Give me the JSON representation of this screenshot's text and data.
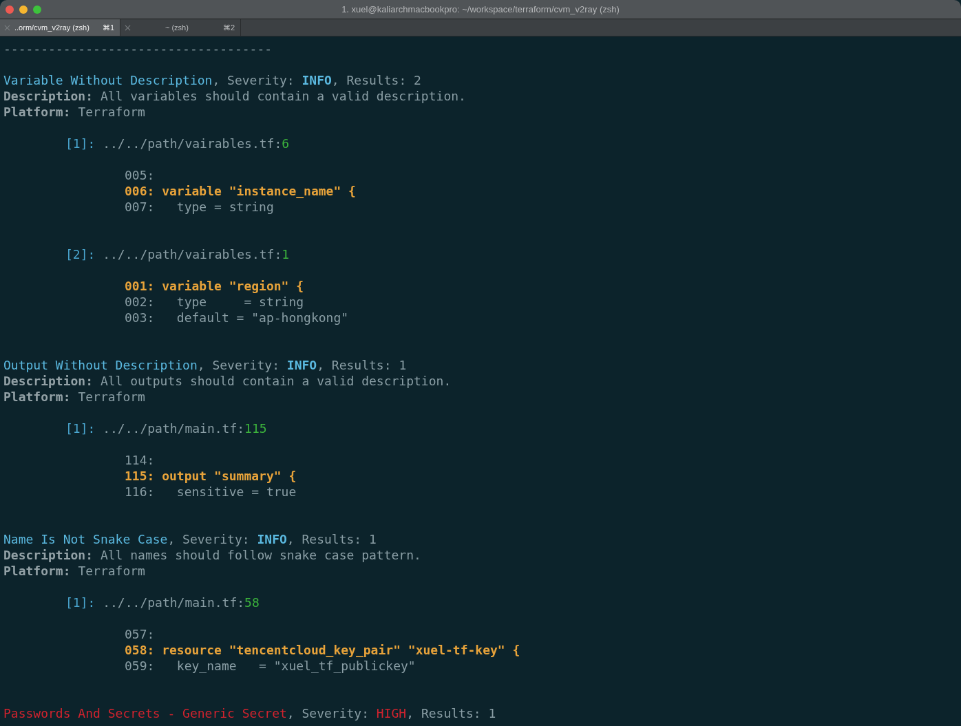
{
  "window": {
    "title": "1. xuel@kaliarchmacbookpro: ~/workspace/terraform/cvm_v2ray (zsh)"
  },
  "tabs": [
    {
      "label": "..orm/cvm_v2ray (zsh)",
      "shortcut": "⌘1",
      "selected": true
    },
    {
      "label": "~ (zsh)",
      "shortcut": "⌘2",
      "selected": false
    }
  ],
  "lines": [
    {
      "kind": "plain",
      "segments": [
        {
          "text": "------------------------------------",
          "kind": "grey"
        }
      ]
    },
    {
      "kind": "blank"
    },
    {
      "kind": "plain",
      "segments": [
        {
          "text": "Variable Without Description",
          "kind": "title"
        },
        {
          "text": ", Severity: ",
          "kind": "grey"
        },
        {
          "text": "INFO",
          "kind": "info"
        },
        {
          "text": ", Results: 2",
          "kind": "grey"
        }
      ]
    },
    {
      "kind": "plain",
      "segments": [
        {
          "text": "Description:",
          "kind": "label"
        },
        {
          "text": " All variables should contain a valid description.",
          "kind": "grey"
        }
      ]
    },
    {
      "kind": "plain",
      "segments": [
        {
          "text": "Platform:",
          "kind": "label"
        },
        {
          "text": " Terraform",
          "kind": "grey"
        }
      ]
    },
    {
      "kind": "blank"
    },
    {
      "kind": "location",
      "segments": [
        {
          "text": "[1]:",
          "kind": "index"
        },
        {
          "text": " ../../path/vairables.tf:",
          "kind": "grey"
        },
        {
          "text": "6",
          "kind": "lineno"
        }
      ]
    },
    {
      "kind": "blank"
    },
    {
      "kind": "code",
      "segments": [
        {
          "text": "005:",
          "kind": "grey"
        }
      ]
    },
    {
      "kind": "code",
      "segments": [
        {
          "text": "006: variable \"instance_name\" {",
          "kind": "hit"
        }
      ]
    },
    {
      "kind": "code",
      "segments": [
        {
          "text": "007:   type = string",
          "kind": "grey"
        }
      ]
    },
    {
      "kind": "blank"
    },
    {
      "kind": "blank"
    },
    {
      "kind": "location",
      "segments": [
        {
          "text": "[2]:",
          "kind": "index"
        },
        {
          "text": " ../../path/vairables.tf:",
          "kind": "grey"
        },
        {
          "text": "1",
          "kind": "lineno"
        }
      ]
    },
    {
      "kind": "blank"
    },
    {
      "kind": "code",
      "segments": [
        {
          "text": "001: variable \"region\" {",
          "kind": "hit"
        }
      ]
    },
    {
      "kind": "code",
      "segments": [
        {
          "text": "002:   type     = string",
          "kind": "grey"
        }
      ]
    },
    {
      "kind": "code",
      "segments": [
        {
          "text": "003:   default = \"ap-hongkong\"",
          "kind": "grey"
        }
      ]
    },
    {
      "kind": "blank"
    },
    {
      "kind": "blank"
    },
    {
      "kind": "plain",
      "segments": [
        {
          "text": "Output Without Description",
          "kind": "title"
        },
        {
          "text": ", Severity: ",
          "kind": "grey"
        },
        {
          "text": "INFO",
          "kind": "info"
        },
        {
          "text": ", Results: 1",
          "kind": "grey"
        }
      ]
    },
    {
      "kind": "plain",
      "segments": [
        {
          "text": "Description:",
          "kind": "label"
        },
        {
          "text": " All outputs should contain a valid description.",
          "kind": "grey"
        }
      ]
    },
    {
      "kind": "plain",
      "segments": [
        {
          "text": "Platform:",
          "kind": "label"
        },
        {
          "text": " Terraform",
          "kind": "grey"
        }
      ]
    },
    {
      "kind": "blank"
    },
    {
      "kind": "location",
      "segments": [
        {
          "text": "[1]:",
          "kind": "index"
        },
        {
          "text": " ../../path/main.tf:",
          "kind": "grey"
        },
        {
          "text": "115",
          "kind": "lineno"
        }
      ]
    },
    {
      "kind": "blank"
    },
    {
      "kind": "code",
      "segments": [
        {
          "text": "114:",
          "kind": "grey"
        }
      ]
    },
    {
      "kind": "code",
      "segments": [
        {
          "text": "115: output \"summary\" {",
          "kind": "hit"
        }
      ]
    },
    {
      "kind": "code",
      "segments": [
        {
          "text": "116:   sensitive = true",
          "kind": "grey"
        }
      ]
    },
    {
      "kind": "blank"
    },
    {
      "kind": "blank"
    },
    {
      "kind": "plain",
      "segments": [
        {
          "text": "Name Is Not Snake Case",
          "kind": "title"
        },
        {
          "text": ", Severity: ",
          "kind": "grey"
        },
        {
          "text": "INFO",
          "kind": "info"
        },
        {
          "text": ", Results: 1",
          "kind": "grey"
        }
      ]
    },
    {
      "kind": "plain",
      "segments": [
        {
          "text": "Description:",
          "kind": "label"
        },
        {
          "text": " All names should follow snake case pattern.",
          "kind": "grey"
        }
      ]
    },
    {
      "kind": "plain",
      "segments": [
        {
          "text": "Platform:",
          "kind": "label"
        },
        {
          "text": " Terraform",
          "kind": "grey"
        }
      ]
    },
    {
      "kind": "blank"
    },
    {
      "kind": "location",
      "segments": [
        {
          "text": "[1]:",
          "kind": "index"
        },
        {
          "text": " ../../path/main.tf:",
          "kind": "grey"
        },
        {
          "text": "58",
          "kind": "lineno"
        }
      ]
    },
    {
      "kind": "blank"
    },
    {
      "kind": "code",
      "segments": [
        {
          "text": "057:",
          "kind": "grey"
        }
      ]
    },
    {
      "kind": "code",
      "segments": [
        {
          "text": "058: resource \"tencentcloud_key_pair\" \"xuel-tf-key\" {",
          "kind": "hit"
        }
      ]
    },
    {
      "kind": "code",
      "segments": [
        {
          "text": "059:   key_name   = \"xuel_tf_publickey\"",
          "kind": "grey"
        }
      ]
    },
    {
      "kind": "blank"
    },
    {
      "kind": "blank"
    },
    {
      "kind": "plain",
      "segments": [
        {
          "text": "Passwords And Secrets - Generic Secret",
          "kind": "danger"
        },
        {
          "text": ", Severity: ",
          "kind": "grey"
        },
        {
          "text": "HIGH",
          "kind": "danger"
        },
        {
          "text": ", Results: 1",
          "kind": "grey"
        }
      ]
    }
  ]
}
